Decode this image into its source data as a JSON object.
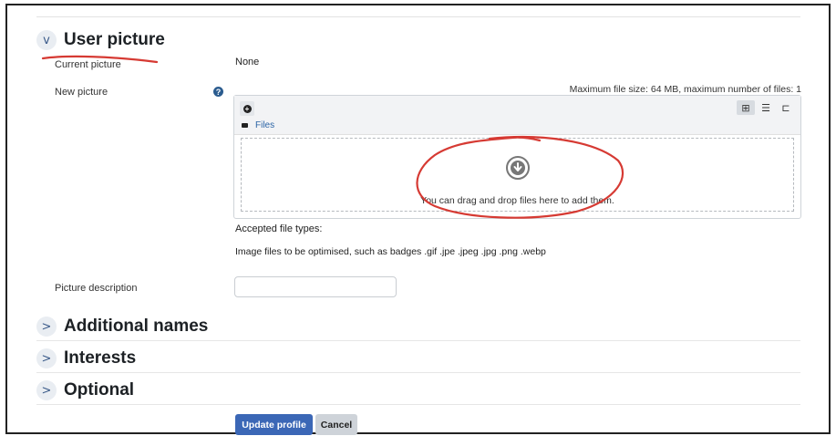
{
  "sections": {
    "user_picture": {
      "chevron": "v",
      "title": "User picture"
    },
    "additional_names": {
      "chevron": ">",
      "title": "Additional names"
    },
    "interests": {
      "chevron": ">",
      "title": "Interests"
    },
    "optional": {
      "chevron": ">",
      "title": "Optional"
    }
  },
  "fields": {
    "current_picture_label": "Current picture",
    "current_picture_value": "None",
    "new_picture_label": "New picture",
    "help_icon": "?",
    "max_info": "Maximum file size: 64 MB, maximum number of files: 1",
    "breadcrumb": "Files",
    "drop_text": "You can drag and drop files here to add them.",
    "accepted_label": "Accepted file types:",
    "accepted_types": "Image files to be optimised, such as badges .gif .jpe .jpeg .jpg .png .webp",
    "picture_description_label": "Picture description",
    "picture_description_value": ""
  },
  "file_picker": {
    "add_icon": "plus-circle-icon",
    "views": [
      "grid-icon",
      "list-icon",
      "tree-icon"
    ],
    "active_view": "grid-icon"
  },
  "buttons": {
    "update": "Update profile",
    "cancel": "Cancel"
  },
  "colors": {
    "primary": "#3b67b6",
    "secondary": "#ced3d9",
    "link": "#2b64a6",
    "annotation": "#d63a33"
  }
}
